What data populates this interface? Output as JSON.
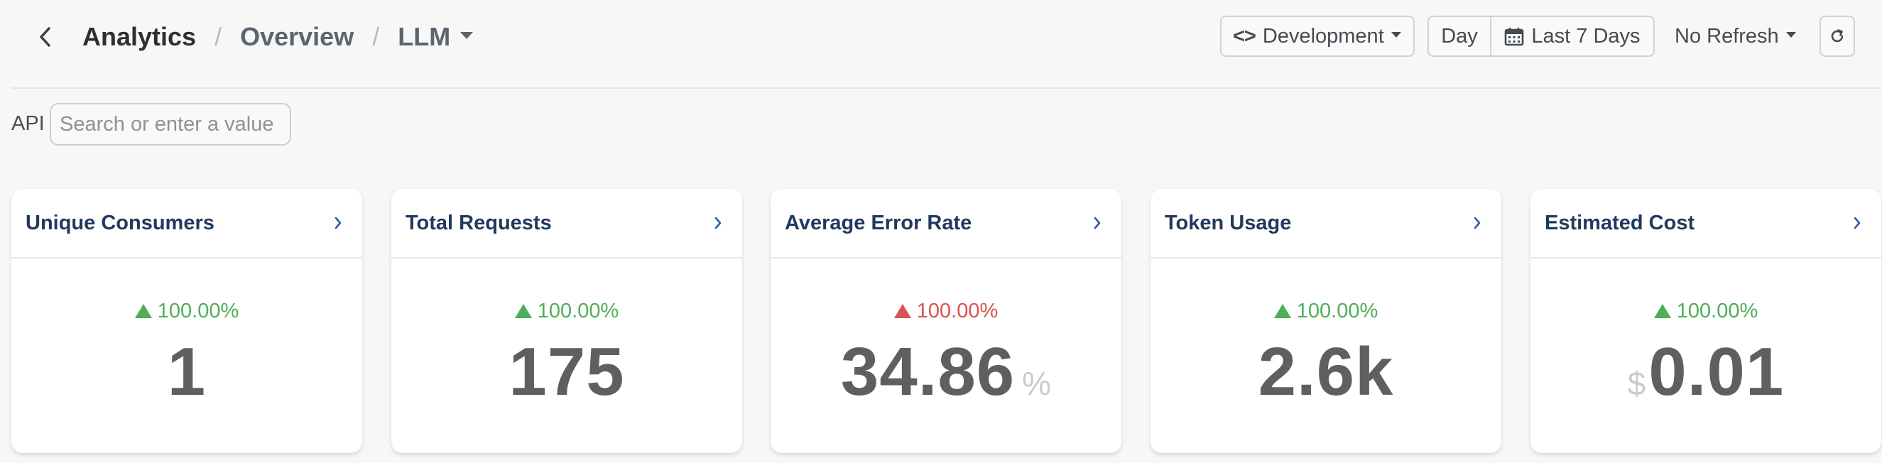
{
  "breadcrumb": {
    "root": "Analytics",
    "separator": "/",
    "parent": "Overview",
    "current": "LLM"
  },
  "toolbar": {
    "environment": "Development",
    "granularity": "Day",
    "date_range": "Last 7 Days",
    "refresh_interval": "No Refresh"
  },
  "filter": {
    "label": "API",
    "placeholder": "Search or enter a value",
    "value": ""
  },
  "colors": {
    "positive": "#4fae5a",
    "negative": "#d9534f",
    "title": "#203a5c",
    "metric": "#5f5f5f"
  },
  "cards": [
    {
      "title": "Unique Consumers",
      "delta": "100.00%",
      "trend": "up",
      "sentiment": "good",
      "value": "1",
      "prefix": "",
      "suffix": ""
    },
    {
      "title": "Total Requests",
      "delta": "100.00%",
      "trend": "up",
      "sentiment": "good",
      "value": "175",
      "prefix": "",
      "suffix": ""
    },
    {
      "title": "Average Error Rate",
      "delta": "100.00%",
      "trend": "up",
      "sentiment": "bad",
      "value": "34.86",
      "prefix": "",
      "suffix": "%"
    },
    {
      "title": "Token Usage",
      "delta": "100.00%",
      "trend": "up",
      "sentiment": "good",
      "value": "2.6k",
      "prefix": "",
      "suffix": ""
    },
    {
      "title": "Estimated Cost",
      "delta": "100.00%",
      "trend": "up",
      "sentiment": "good",
      "value": "0.01",
      "prefix": "$",
      "suffix": ""
    }
  ]
}
